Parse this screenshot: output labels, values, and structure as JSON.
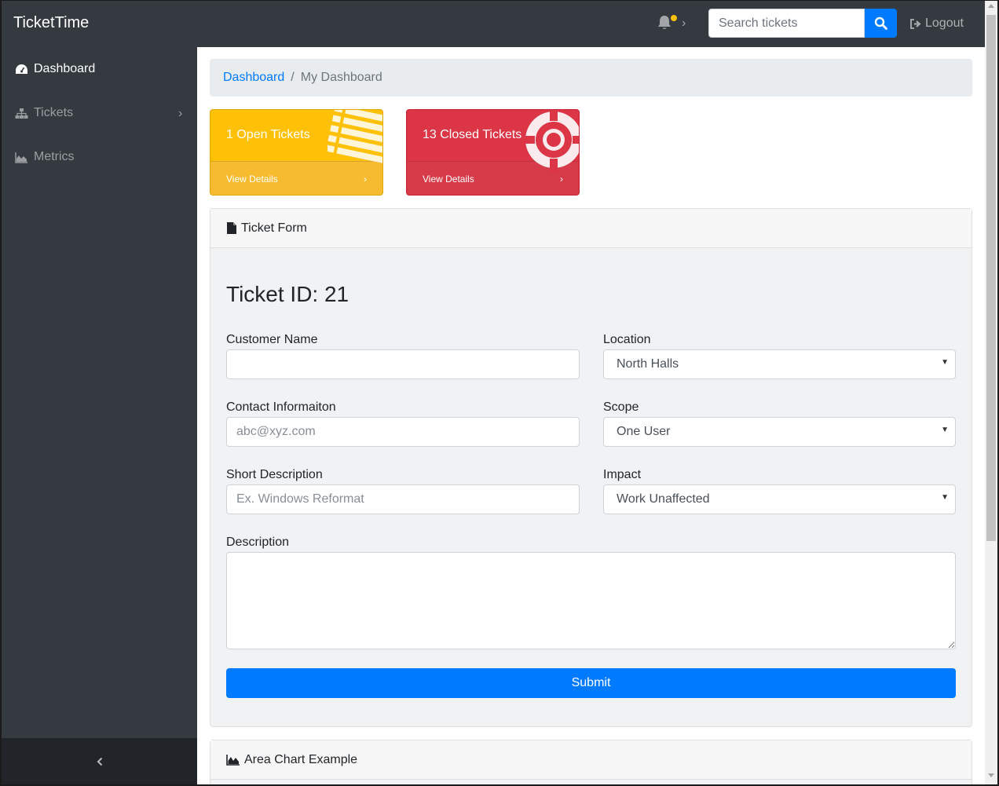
{
  "app": {
    "brand": "TicketTime"
  },
  "navbar": {
    "search_placeholder": "Search tickets",
    "logout_label": "Logout",
    "notification_dot_color": "#ffc107"
  },
  "sidebar": {
    "items": [
      {
        "label": "Dashboard",
        "icon": "dashboard-icon",
        "active": true
      },
      {
        "label": "Tickets",
        "icon": "sitemap-icon",
        "active": false
      },
      {
        "label": "Metrics",
        "icon": "area-chart-icon",
        "active": false
      }
    ]
  },
  "breadcrumb": {
    "root": "Dashboard",
    "separator": "/",
    "current": "My Dashboard"
  },
  "stats": [
    {
      "title": "1 Open Tickets",
      "link": "View Details",
      "color": "#ffc107",
      "icon": "list-icon"
    },
    {
      "title": "13 Closed Tickets",
      "link": "View Details",
      "color": "#dc3545",
      "icon": "life-ring-icon"
    }
  ],
  "form": {
    "header": "Ticket Form",
    "ticket_id": "Ticket ID: 21",
    "customer_name": {
      "label": "Customer Name",
      "value": "",
      "placeholder": ""
    },
    "contact": {
      "label": "Contact Informaiton",
      "placeholder": "abc@xyz.com"
    },
    "short_description": {
      "label": "Short Description",
      "placeholder": "Ex. Windows Reformat"
    },
    "location": {
      "label": "Location",
      "value": "North Halls"
    },
    "scope": {
      "label": "Scope",
      "value": "One User"
    },
    "impact": {
      "label": "Impact",
      "value": "Work Unaffected"
    },
    "description": {
      "label": "Description",
      "value": ""
    },
    "submit_label": "Submit"
  },
  "chart_card": {
    "header": "Area Chart Example"
  },
  "colors": {
    "primary": "#007bff",
    "dark": "#343a40",
    "darker": "#212529"
  }
}
